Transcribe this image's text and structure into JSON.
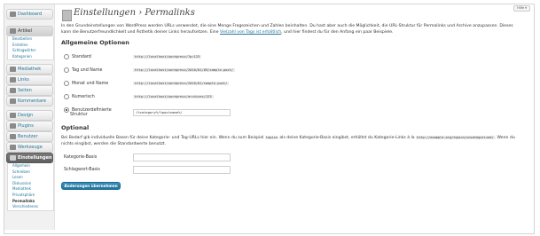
{
  "help": {
    "label": "Hilfe ▾"
  },
  "sidebar": {
    "dashboard": "Dashboard",
    "artikel": "Artikel",
    "artikel_sub": [
      "Bearbeiten",
      "Erstellen",
      "Schlagwörter",
      "Kategorien"
    ],
    "mediathek": "Mediathek",
    "links": "Links",
    "seiten": "Seiten",
    "kommentare": "Kommentare",
    "design": "Design",
    "plugins": "Plugins",
    "benutzer": "Benutzer",
    "werkzeuge": "Werkzeuge",
    "einstellungen": "Einstellungen",
    "einstellungen_sub": [
      "Allgemein",
      "Schreiben",
      "Lesen",
      "Diskussion",
      "Mediathek",
      "Privatsphäre",
      "Permalinks",
      "Verschiedenes"
    ]
  },
  "page": {
    "title": "Einstellungen › Permalinks",
    "intro_1": "In den Grundeinstellungen von WordPress werden URLs verwendet, die eine Menge Fragezeichen und Zahlen beinhalten. Du hast aber auch die Möglichkeit, die URL-Struktur für Permalinks und Archive anzupassen. Dieses kann die Benutzerfreundlichkeit und Ästhetik deiner Links heraufsetzen. Eine ",
    "intro_link": "Vielzahl von Tags ist erhältlich",
    "intro_2": ", und hier findest du für den Anfang ein paar Beispiele."
  },
  "common": {
    "heading": "Allgemeine Optionen",
    "options": [
      {
        "label": "Standard",
        "example": "http://localhost/wordpress/?p=123"
      },
      {
        "label": "Tag und Name",
        "example": "http://localhost/wordpress/2010/01/09/sample-post/"
      },
      {
        "label": "Monat und Name",
        "example": "http://localhost/wordpress/2010/01/sample-post/"
      },
      {
        "label": "Numerisch",
        "example": "http://localhost/wordpress/archives/123"
      },
      {
        "label_1": "Benutzerdefinierte",
        "label_2": "Struktur",
        "value": "/%category%/%postname%/"
      }
    ]
  },
  "optional": {
    "heading": "Optional",
    "desc_1": "Bei Bedarf gib individuelle Basen für deine Kategorie- und Tag-URLs hier ein. Wenn du zum Beispiel ",
    "desc_code_1": "topics",
    "desc_2": " als deine Kategorie-Basis eingibst, erhältst du Kategorie-Links à la ",
    "desc_code_2": "http://example.org/topics/uncategorized/",
    "desc_3": ". Wenn du nichts eingibst, werden die Standardwerte benutzt.",
    "category_label": "Kategorie-Basis",
    "tag_label": "Schlagwort-Basis",
    "category_value": "",
    "tag_value": ""
  },
  "save_label": "Änderungen übernehmen"
}
